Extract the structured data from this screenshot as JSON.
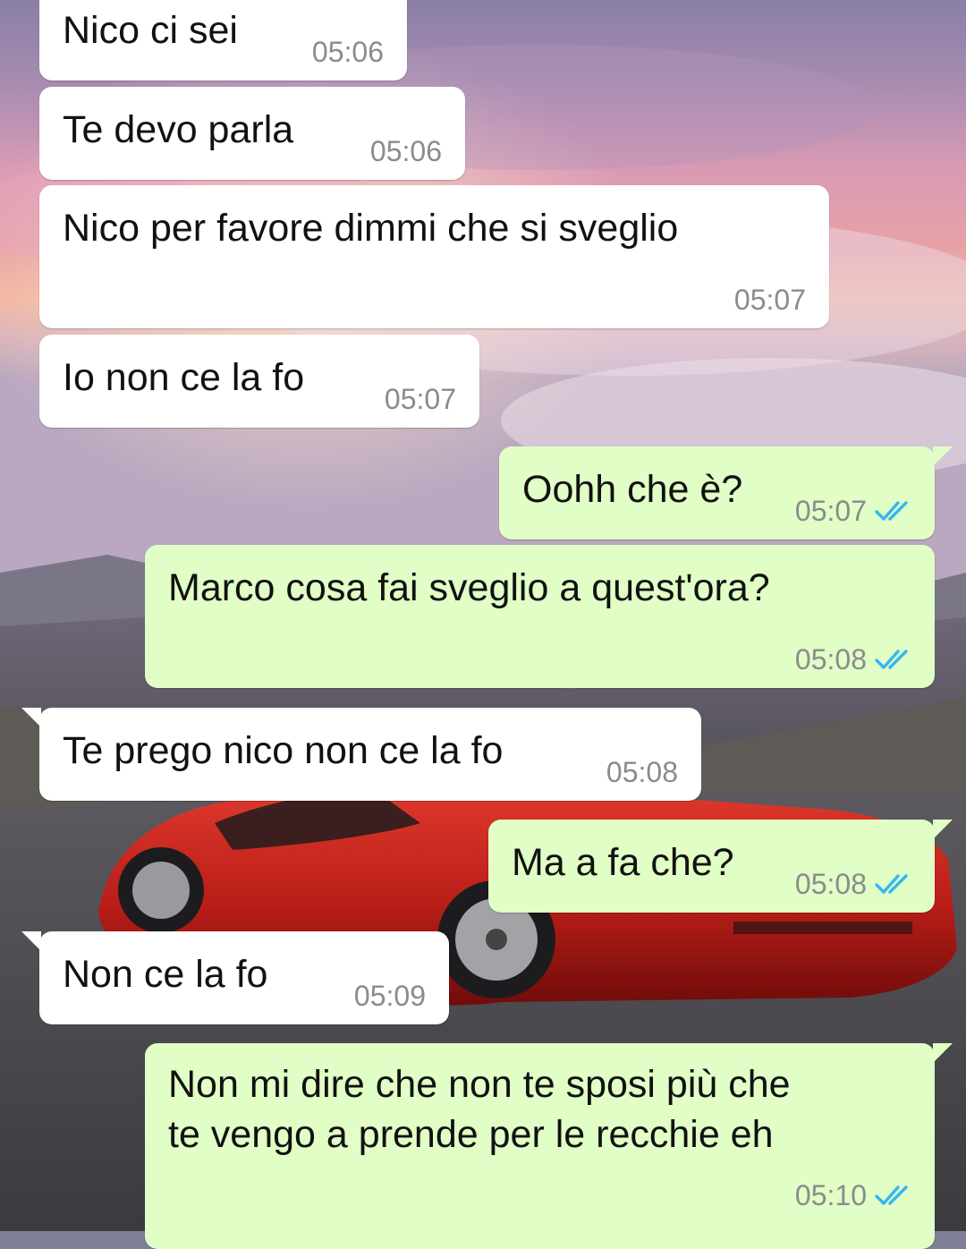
{
  "colors": {
    "incoming_bubble": "#ffffff",
    "outgoing_bubble": "#e1fec6",
    "timestamp": "#8b8b8b",
    "read_ticks": "#34b7f1"
  },
  "wallpaper": {
    "description_icon": "sunset-red-sports-car-wallpaper"
  },
  "messages": [
    {
      "direction": "in",
      "text": "Nico ci sei",
      "time": "05:06"
    },
    {
      "direction": "in",
      "text": "Te devo parla",
      "time": "05:06"
    },
    {
      "direction": "in",
      "text": "Nico per favore dimmi che si sveglio",
      "time": "05:07"
    },
    {
      "direction": "in",
      "text": "Io non ce la fo",
      "time": "05:07"
    },
    {
      "direction": "out",
      "text": "Oohh che è?",
      "time": "05:07",
      "status": "read"
    },
    {
      "direction": "out",
      "text": "Marco cosa fai sveglio a quest'ora?",
      "time": "05:08",
      "status": "read"
    },
    {
      "direction": "in",
      "text": "Te prego nico non ce la fo",
      "time": "05:08"
    },
    {
      "direction": "out",
      "text": "Ma a fa che?",
      "time": "05:08",
      "status": "read"
    },
    {
      "direction": "in",
      "text": "Non ce la fo",
      "time": "05:09"
    },
    {
      "direction": "out",
      "text": "Non mi dire che non te sposi più che\nte vengo a prende per le recchie eh",
      "time": "05:10",
      "status": "read"
    }
  ]
}
